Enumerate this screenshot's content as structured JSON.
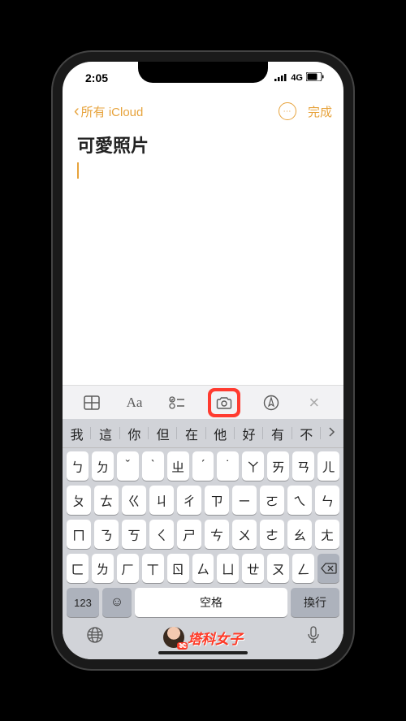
{
  "status": {
    "time": "2:05",
    "network": "4G"
  },
  "nav": {
    "back_label": "所有 iCloud",
    "done_label": "完成"
  },
  "note": {
    "title": "可愛照片"
  },
  "toolbar": {
    "items": [
      "table",
      "text-format",
      "checklist",
      "camera",
      "markup",
      "close"
    ]
  },
  "suggestions": [
    "我",
    "這",
    "你",
    "但",
    "在",
    "他",
    "好",
    "有",
    "不"
  ],
  "keyboard": {
    "rows": [
      [
        "ㄅ",
        "ㄉ",
        "ˇ",
        "ˋ",
        "ㄓ",
        "ˊ",
        "˙",
        "ㄚ",
        "ㄞ",
        "ㄢ",
        "ㄦ"
      ],
      [
        "ㄆ",
        "ㄊ",
        "ㄍ",
        "ㄐ",
        "ㄔ",
        "ㄗ",
        "ㄧ",
        "ㄛ",
        "ㄟ",
        "ㄣ"
      ],
      [
        "ㄇ",
        "ㄋ",
        "ㄎ",
        "ㄑ",
        "ㄕ",
        "ㄘ",
        "ㄨ",
        "ㄜ",
        "ㄠ",
        "ㄤ"
      ],
      [
        "ㄈ",
        "ㄌ",
        "ㄏ",
        "ㄒ",
        "ㄖ",
        "ㄙ",
        "ㄩ",
        "ㄝ",
        "ㄡ",
        "ㄥ"
      ]
    ],
    "num_label": "123",
    "space_label": "空格",
    "return_label": "換行"
  },
  "watermark": {
    "text": "塔科女子",
    "badge": "3C"
  }
}
